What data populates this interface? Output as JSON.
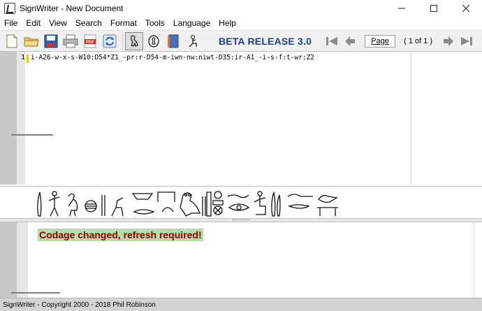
{
  "window": {
    "title": "SignWriter - New Document",
    "icon": "signwriter-app-icon",
    "controls": [
      "minimize-icon",
      "maximize-icon",
      "close-icon"
    ]
  },
  "menu": {
    "items": [
      "File",
      "Edit",
      "View",
      "Search",
      "Format",
      "Tools",
      "Language",
      "Help"
    ]
  },
  "toolbar": {
    "buttons": [
      {
        "name": "new-document-icon"
      },
      {
        "name": "open-folder-icon"
      },
      {
        "name": "save-icon"
      },
      {
        "name": "print-icon"
      },
      {
        "name": "pdf-icon",
        "label": "PDF"
      },
      {
        "name": "refresh-icon"
      },
      {
        "name": "hieroglyph-bird-icon",
        "pressed": true
      },
      {
        "name": "hieroglyph-cartouche-icon"
      },
      {
        "name": "book-icon"
      },
      {
        "name": "seated-figure-icon"
      }
    ],
    "beta_label": "BETA RELEASE 3.0",
    "page_label": "Page",
    "page_count": "( 1 of 1 )",
    "nav": [
      "first-page-icon",
      "previous-page-icon",
      "next-page-icon",
      "last-page-icon"
    ]
  },
  "editor": {
    "line_number": "1",
    "code": "i-A26-w-x-s-W10:D54*Z1_-pr:r-D54-m-iwn-nw:niwt-D35:ir-A1_-i-s-f:t-wr:Z2"
  },
  "glyph_preview": {
    "glyphs": [
      "reed-leaf",
      "man-pointing",
      "quail-chick",
      "folded-cloth",
      "placenta",
      "basket",
      "legs-walking",
      "jar-stand",
      "mouth",
      "owl",
      "pool",
      "water",
      "city",
      "eye",
      "man-seated",
      "reed-leaf",
      "horned-viper",
      "bolt",
      "bread-loaf",
      "swallow",
      "flat-bread"
    ]
  },
  "output": {
    "message": "Codage changed, refresh required!",
    "message_color": "#8b0000",
    "highlight_color": "#b8dca8"
  },
  "status": {
    "text": "SignWriter - Copyright 2000 - 2018 Phil Robinson"
  }
}
